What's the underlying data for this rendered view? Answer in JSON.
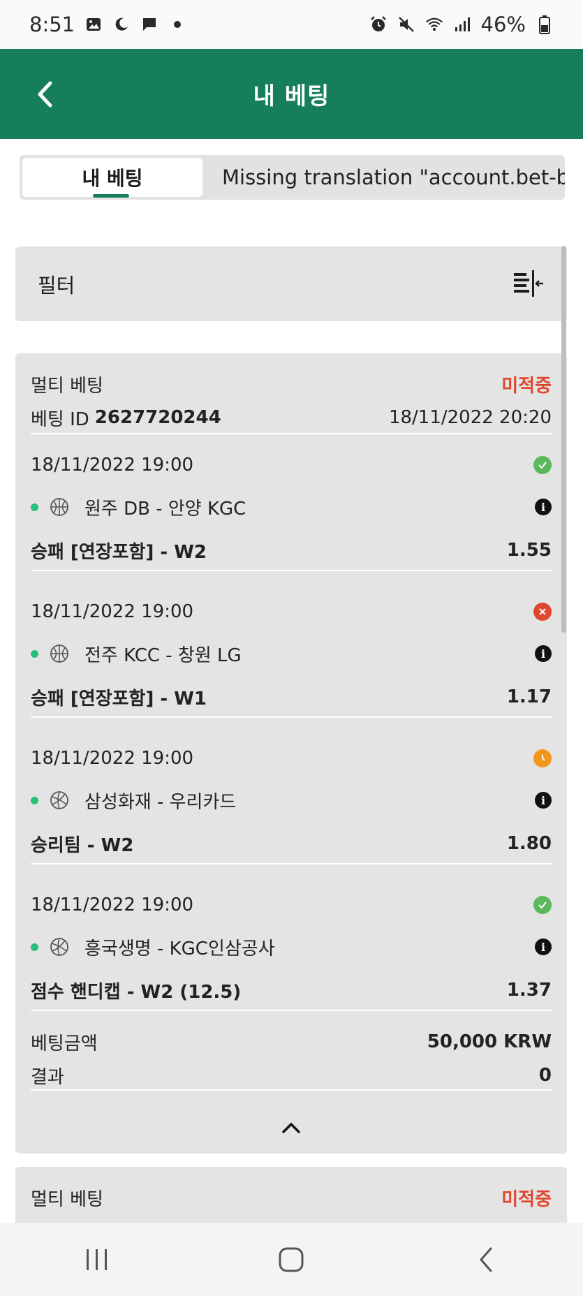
{
  "status_bar": {
    "time": "8:51",
    "battery": "46%"
  },
  "header": {
    "title": "내 베팅"
  },
  "tabs": [
    {
      "label": "내 베팅",
      "active": true
    },
    {
      "label": "Missing translation \"account.bet-b",
      "active": false
    }
  ],
  "filter": {
    "label": "필터"
  },
  "bet": {
    "type_label": "멀티 베팅",
    "status": "미적중",
    "id_label": "베팅 ID",
    "id_value": "2627720244",
    "placed_at": "18/11/2022 20:20",
    "selections": [
      {
        "datetime": "18/11/2022 19:00",
        "result": "won",
        "sport": "basketball",
        "match": "원주 DB - 안양 KGC",
        "market": "승패 [연장포함] - W2",
        "odds": "1.55"
      },
      {
        "datetime": "18/11/2022 19:00",
        "result": "lost",
        "sport": "basketball",
        "match": "전주 KCC - 창원 LG",
        "market": "승패 [연장포함] - W1",
        "odds": "1.17"
      },
      {
        "datetime": "18/11/2022 19:00",
        "result": "pending",
        "sport": "volleyball",
        "match": "삼성화재 - 우리카드",
        "market": "승리팀 - W2",
        "odds": "1.80"
      },
      {
        "datetime": "18/11/2022 19:00",
        "result": "won",
        "sport": "volleyball",
        "match": "흥국생명 - KGC인삼공사",
        "market": "점수 핸디캡 - W2 (12.5)",
        "odds": "1.37"
      }
    ],
    "stake_label": "베팅금액",
    "stake_value": "50,000 KRW",
    "result_label": "결과",
    "result_value": "0"
  },
  "bet2": {
    "type_label": "멀티 베팅",
    "status": "미적중"
  },
  "colors": {
    "brand_green": "#177e5c",
    "lost_red": "#e0472e",
    "won_green": "#5cb85c",
    "pending_orange": "#f0961c",
    "live_dot": "#27c07b"
  }
}
